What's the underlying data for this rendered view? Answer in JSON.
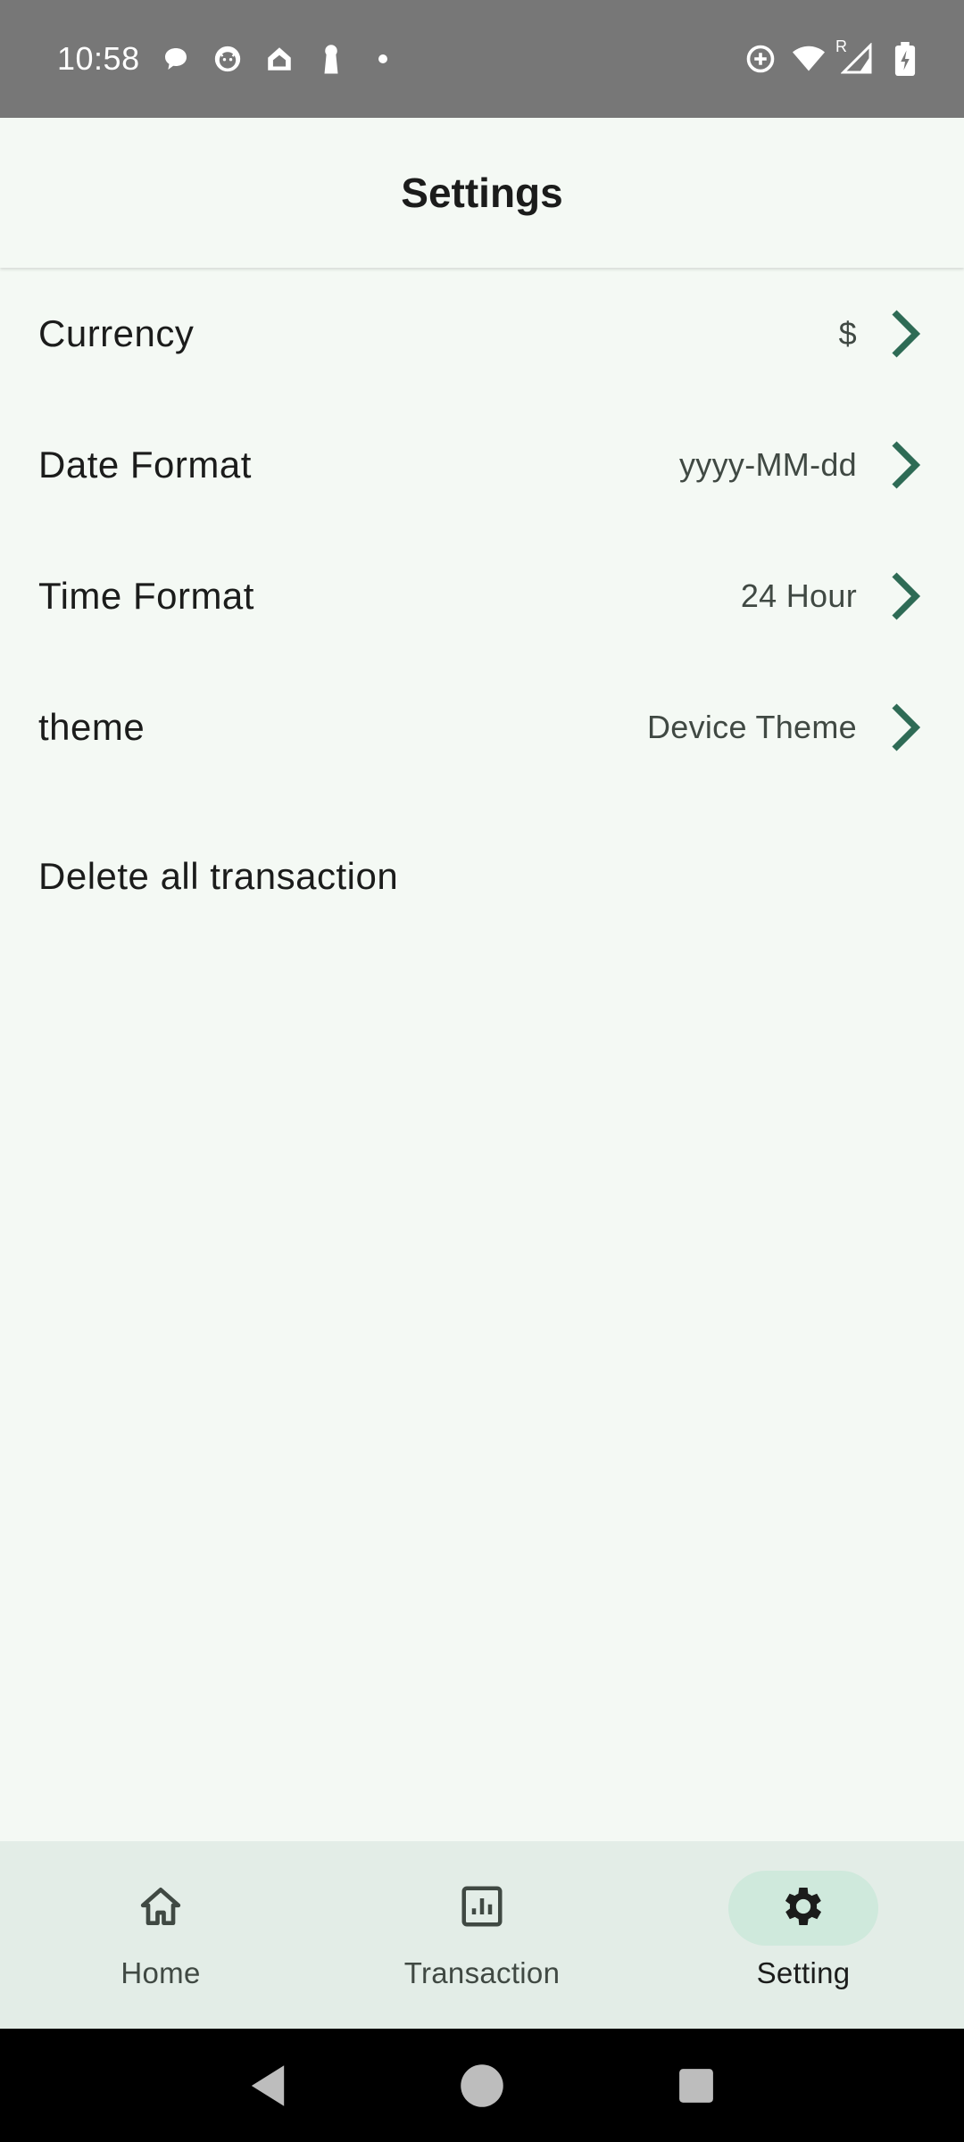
{
  "status_bar": {
    "time": "10:58",
    "left_icons": [
      "chat-bubble-icon",
      "cat-face-icon",
      "home-outline-icon",
      "keyhole-icon",
      "dot-icon"
    ],
    "right_icons": [
      "data-saver-icon",
      "wifi-icon",
      "signal-icon",
      "battery-charging-icon"
    ],
    "signal_roaming_label": "R"
  },
  "top_bar": {
    "title": "Settings"
  },
  "settings": [
    {
      "label": "Currency",
      "value": "$"
    },
    {
      "label": "Date Format",
      "value": "yyyy-MM-dd"
    },
    {
      "label": "Time Format",
      "value": "24 Hour"
    },
    {
      "label": "theme",
      "value": "Device Theme"
    }
  ],
  "delete_all": {
    "label": "Delete all transaction"
  },
  "bottom_nav": {
    "items": [
      {
        "label": "Home",
        "icon": "home-icon",
        "active": false
      },
      {
        "label": "Transaction",
        "icon": "bar-chart-icon",
        "active": false
      },
      {
        "label": "Setting",
        "icon": "gear-icon",
        "active": true
      }
    ]
  },
  "colors": {
    "accent": "#2e6b55",
    "background": "#f4f9f4",
    "nav_background": "#e3ede7",
    "active_indicator": "#cfe9dc",
    "status_bar": "#777777"
  }
}
